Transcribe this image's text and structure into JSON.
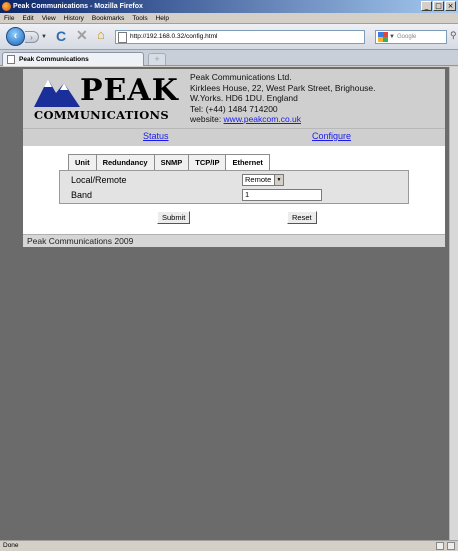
{
  "window": {
    "title": "Peak Communications - Mozilla Firefox",
    "controls": [
      "_",
      "□",
      "×"
    ]
  },
  "menu": [
    "File",
    "Edit",
    "View",
    "History",
    "Bookmarks",
    "Tools",
    "Help"
  ],
  "toolbar": {
    "url": "http://192.168.0.32/config.html",
    "search_placeholder": "Google"
  },
  "tab": {
    "label": "Peak Communications",
    "new_tab": "+"
  },
  "page": {
    "logo": {
      "peak": "PEAK",
      "communications": "COMMUNICATIONS"
    },
    "company": {
      "name": "Peak Communications Ltd.",
      "address1": "Kirklees House, 22, West Park Street, Brighouse.",
      "address2": "W.Yorks. HD6 1DU. England",
      "tel": "Tel: (+44) 1484 714200",
      "website_prefix": "website: ",
      "website": "www.peakcom.co.uk"
    },
    "nav": {
      "status": "Status",
      "configure": "Configure"
    },
    "tabs": [
      "Unit",
      "Redundancy",
      "SNMP",
      "TCP/IP",
      "Ethernet"
    ],
    "form": {
      "local_remote_label": "Local/Remote",
      "local_remote_value": "Remote",
      "band_label": "Band",
      "band_value": "1"
    },
    "buttons": {
      "submit": "Submit",
      "reset": "Reset"
    },
    "footer": "Peak Communications 2009"
  },
  "status": {
    "text": "Done"
  }
}
